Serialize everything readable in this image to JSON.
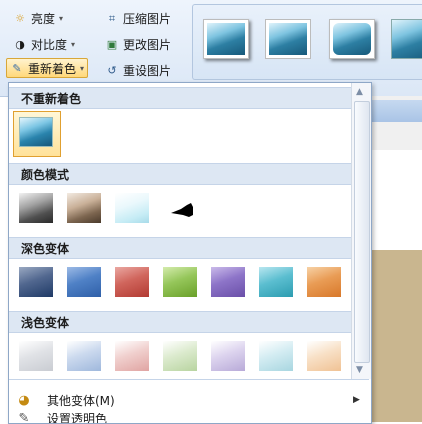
{
  "ribbon": {
    "brightness_label": "亮度",
    "contrast_label": "对比度",
    "recolor_label": "重新着色",
    "compress_label": "压缩图片",
    "change_picture_label": "更改图片",
    "reset_picture_label": "重设图片"
  },
  "dropdown": {
    "sections": {
      "no_recolor": "不重新着色",
      "color_modes": "颜色模式",
      "dark_variations": "深色变体",
      "light_variations": "浅色变体"
    },
    "more_variations_label": "其他变体(M)",
    "next_item_partial": "设置透明色"
  },
  "colors": {
    "accent": "#e0a030",
    "header_bg": "#dde7f3",
    "dark_variants": [
      "#1f3a66",
      "#2f5fa8",
      "#b23a32",
      "#6aa02a",
      "#6a4fa8",
      "#2c9cb0",
      "#d8782a"
    ],
    "light_variants": [
      "#c9ccd2",
      "#9fb8dc",
      "#e0a4a2",
      "#b8d4a0",
      "#b8aad8",
      "#a8d6e0",
      "#f0c294"
    ]
  }
}
